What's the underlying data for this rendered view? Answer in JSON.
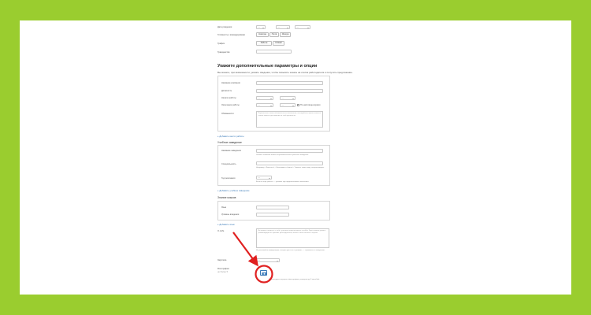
{
  "top_rows": [
    {
      "label": "Дата рождения",
      "fields": [
        "—",
        "—",
        "—"
      ]
    },
    {
      "label": "Готовность к командировкам",
      "buttons": [
        "Никогда",
        "Готов",
        "Иногда"
      ]
    },
    {
      "label": "График",
      "buttons": [
        "Работа",
        "Гибкий"
      ]
    },
    {
      "label": "Гражданство"
    }
  ],
  "section_title": "Укажите дополнительные параметры и опции",
  "section_subtitle": "Вы можете, при возможности, указать сведения, чтобы повысить шансы на отклик работодателя и получить предложение.",
  "work_block": {
    "labels": [
      "Название компании",
      "Должность",
      "Начало работы",
      "Окончание работы",
      "Обязанности"
    ],
    "selects": [
      "—",
      "—",
      "—",
      "—"
    ],
    "checkbox_label": "По настоящее время",
    "textarea_placeholder": "Перечислите, какие обязанности вы выполняли, постарайтесь кратко описать самые важные достижения на этой должности."
  },
  "add_work": "Добавить место работы",
  "edu": {
    "title": "Учебное заведение",
    "labels": [
      "Название заведения",
      "Специальность",
      "Год окончания"
    ],
    "hints": [
      "Укажите название вашего образовательного учебного заведения.",
      "Например, «Финансы», «Экономика и бизнес». Укажите также вашу специализацию.",
      "Если вы еще учитесь — укажите год предполагаемого окончания."
    ],
    "year_select": "—"
  },
  "add_edu": "Добавить учебное заведение",
  "lang": {
    "title": "Знание языков",
    "labels": [
      "Язык",
      "Уровень владения"
    ]
  },
  "add_lang": "Добавить язык",
  "about": {
    "label": "О себе",
    "placeholder": "Вы можете написать о себе, уточните ваши интересы и хобби. Здесь можно указать рекомендации от прежних работодателей, описать свои сильные стороны.",
    "hint": "Не указывайте информацию, которая уже есть в резюме, — стремитесь к конкретике."
  },
  "currency": {
    "label": "Зарплата",
    "value": "—"
  },
  "photo": {
    "label": "Фотография",
    "sublabel": "не более 5",
    "hint": "Рекомендуем загружать фотографию, размером до 5 мегабайт."
  },
  "colors": {
    "background": "#9acd2f",
    "annotation": "#e02020",
    "link": "#3a7ab8"
  }
}
